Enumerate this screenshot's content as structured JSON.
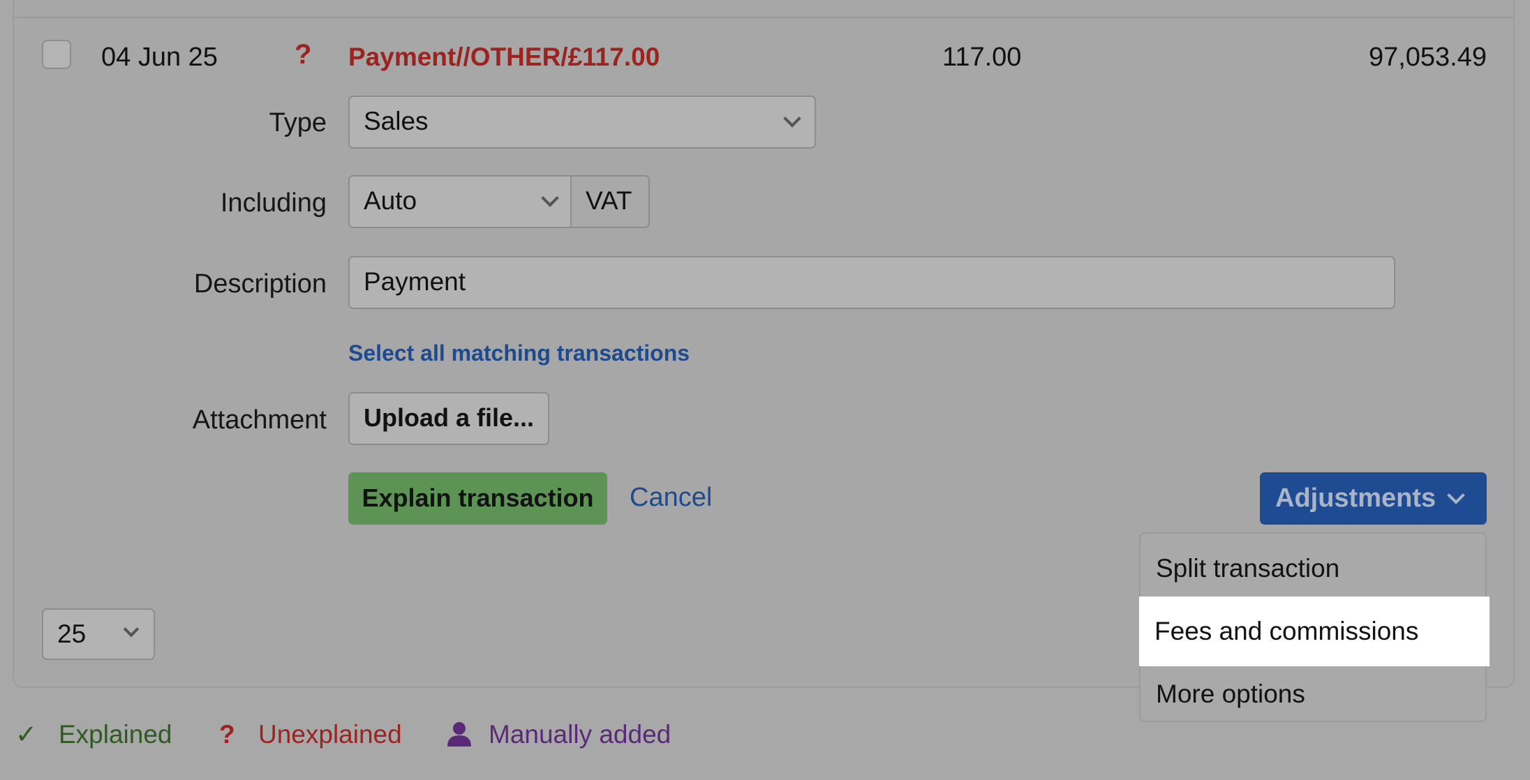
{
  "row": {
    "date": "04 Jun 25",
    "status_icon": "question-mark-icon",
    "description": "Payment//OTHER/£117.00",
    "amount": "117.00",
    "balance": "97,053.49"
  },
  "form": {
    "type_label": "Type",
    "type_value": "Sales",
    "including_label": "Including",
    "including_value": "Auto",
    "vat_label": "VAT",
    "description_label": "Description",
    "description_value": "Payment",
    "select_matching_link": "Select all matching transactions",
    "attachment_label": "Attachment",
    "upload_button": "Upload a file...",
    "explain_button": "Explain transaction",
    "cancel_link": "Cancel",
    "adjustments_button": "Adjustments"
  },
  "adjustments_menu": {
    "items": [
      {
        "label": "Split transaction"
      },
      {
        "label": "Fees and commissions",
        "highlighted": true
      },
      {
        "label": "More options"
      }
    ]
  },
  "pagination": {
    "per_page": "25"
  },
  "legend": {
    "explained": "Explained",
    "unexplained": "Unexplained",
    "manually_added": "Manually added"
  },
  "colors": {
    "unexplained_red": "#9b2420",
    "link_blue": "#1f4a8c",
    "explain_green": "#5d9455",
    "adjust_blue": "#1e4b92",
    "explained_green": "#2f5a22",
    "manual_purple": "#5a2a78"
  }
}
